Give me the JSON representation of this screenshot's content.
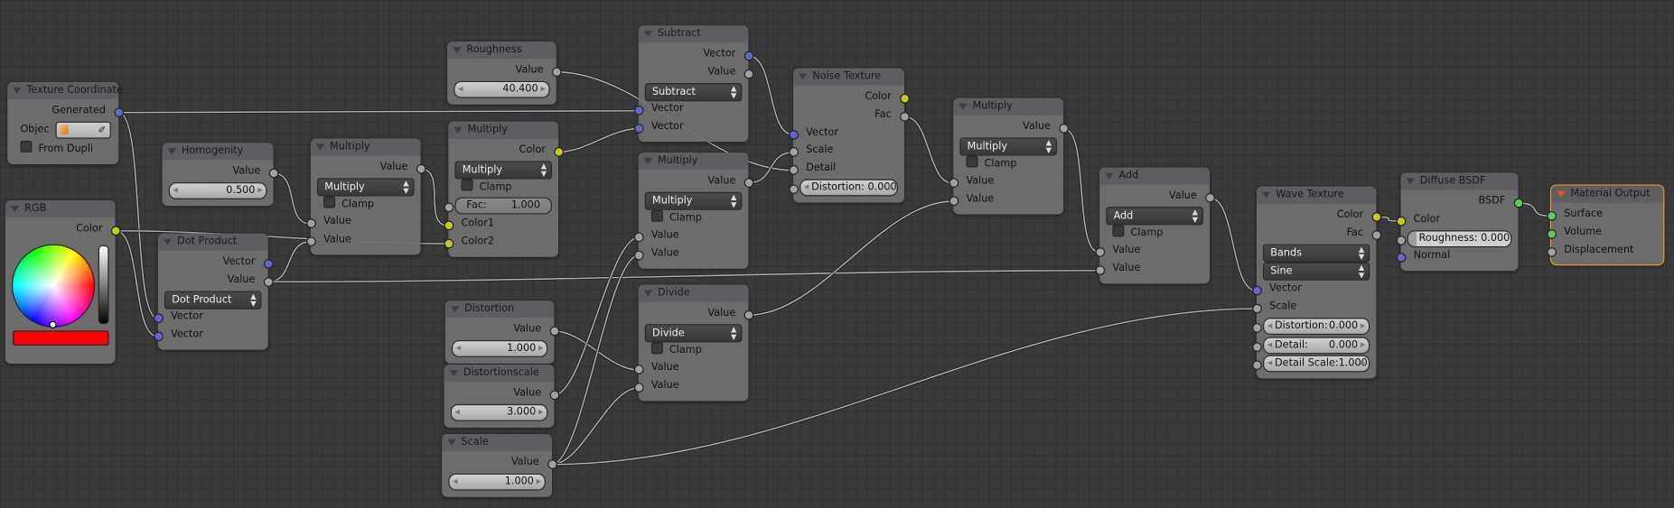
{
  "editor": "node-editor",
  "socket_colors": {
    "vector": "#6464cc",
    "value": "#a1a1a1",
    "color": "#c7c729",
    "shader": "#63c763"
  },
  "link_color": "#b4b4b4",
  "accent_active": "#f0a030",
  "nodes": [
    {
      "id": "texcoord",
      "title": "Texture Coordinate",
      "rows": [
        {
          "kind": "out",
          "label": "Generated",
          "socket": "vector"
        },
        {
          "kind": "object",
          "label": "Objec",
          "icon": "cube-icon",
          "picker_icon": "eyedropper-icon"
        },
        {
          "kind": "check",
          "label": "From Dupli",
          "checked": false
        }
      ]
    },
    {
      "id": "rgb",
      "title": "RGB",
      "rows": [
        {
          "kind": "out",
          "label": "Color",
          "socket": "color"
        },
        {
          "kind": "picker",
          "swatch": "#ff0000"
        }
      ]
    },
    {
      "id": "homogenity",
      "title": "Homogenity",
      "rows": [
        {
          "kind": "out",
          "label": "Value",
          "socket": "value"
        },
        {
          "kind": "field",
          "label": "",
          "value": "0.500",
          "arrows": true
        }
      ]
    },
    {
      "id": "dot",
      "title": "Dot Product",
      "rows": [
        {
          "kind": "out",
          "label": "Vector",
          "socket": "vector"
        },
        {
          "kind": "out",
          "label": "Value",
          "socket": "value"
        },
        {
          "kind": "menu",
          "label": "Dot Product"
        },
        {
          "kind": "in",
          "label": "Vector",
          "socket": "vector"
        },
        {
          "kind": "in",
          "label": "Vector",
          "socket": "vector"
        }
      ]
    },
    {
      "id": "mul1",
      "title": "Multiply",
      "rows": [
        {
          "kind": "out",
          "label": "Value",
          "socket": "value"
        },
        {
          "kind": "menu",
          "label": "Multiply"
        },
        {
          "kind": "check",
          "label": "Clamp",
          "checked": false
        },
        {
          "kind": "in",
          "label": "Value",
          "socket": "value"
        },
        {
          "kind": "in",
          "label": "Value",
          "socket": "value"
        }
      ]
    },
    {
      "id": "roughness",
      "title": "Roughness",
      "rows": [
        {
          "kind": "out",
          "label": "Value",
          "socket": "value"
        },
        {
          "kind": "field",
          "label": "",
          "value": "40.400",
          "arrows": true
        }
      ]
    },
    {
      "id": "mix",
      "title": "Multiply",
      "rows": [
        {
          "kind": "out",
          "label": "Color",
          "socket": "color"
        },
        {
          "kind": "menu",
          "label": "Multiply"
        },
        {
          "kind": "check",
          "label": "Clamp",
          "checked": false
        },
        {
          "kind": "field",
          "label": "Fac:",
          "value": "1.000",
          "socket": "value",
          "plain": true
        },
        {
          "kind": "in",
          "label": "Color1",
          "socket": "color"
        },
        {
          "kind": "in",
          "label": "Color2",
          "socket": "color"
        }
      ]
    },
    {
      "id": "subtract",
      "title": "Subtract",
      "rows": [
        {
          "kind": "out",
          "label": "Vector",
          "socket": "vector"
        },
        {
          "kind": "out",
          "label": "Value",
          "socket": "value"
        },
        {
          "kind": "menu",
          "label": "Subtract"
        },
        {
          "kind": "in",
          "label": "Vector",
          "socket": "vector"
        },
        {
          "kind": "in",
          "label": "Vector",
          "socket": "vector"
        }
      ]
    },
    {
      "id": "mul3",
      "title": "Multiply",
      "rows": [
        {
          "kind": "out",
          "label": "Value",
          "socket": "value"
        },
        {
          "kind": "menu",
          "label": "Multiply"
        },
        {
          "kind": "check",
          "label": "Clamp",
          "checked": false
        },
        {
          "kind": "in",
          "label": "Value",
          "socket": "value"
        },
        {
          "kind": "in",
          "label": "Value",
          "socket": "value"
        }
      ]
    },
    {
      "id": "noise",
      "title": "Noise Texture",
      "rows": [
        {
          "kind": "out",
          "label": "Color",
          "socket": "color"
        },
        {
          "kind": "out",
          "label": "Fac",
          "socket": "value"
        },
        {
          "kind": "in",
          "label": "Vector",
          "socket": "vector"
        },
        {
          "kind": "in",
          "label": "Scale",
          "socket": "value"
        },
        {
          "kind": "in",
          "label": "Detail",
          "socket": "value"
        },
        {
          "kind": "field",
          "label": "Distortion: 0.000",
          "value": "",
          "socket": "value",
          "arrows": true
        }
      ]
    },
    {
      "id": "distortion",
      "title": "Distortion",
      "rows": [
        {
          "kind": "out",
          "label": "Value",
          "socket": "value"
        },
        {
          "kind": "field",
          "label": "",
          "value": "1.000",
          "arrows": true
        }
      ]
    },
    {
      "id": "distscale",
      "title": "Distortionscale",
      "rows": [
        {
          "kind": "out",
          "label": "Value",
          "socket": "value"
        },
        {
          "kind": "field",
          "label": "",
          "value": "3.000",
          "arrows": true
        }
      ]
    },
    {
      "id": "scale",
      "title": "Scale",
      "rows": [
        {
          "kind": "out",
          "label": "Value",
          "socket": "value"
        },
        {
          "kind": "field",
          "label": "",
          "value": "1.000",
          "arrows": true
        }
      ]
    },
    {
      "id": "divide",
      "title": "Divide",
      "rows": [
        {
          "kind": "out",
          "label": "Value",
          "socket": "value"
        },
        {
          "kind": "menu",
          "label": "Divide"
        },
        {
          "kind": "check",
          "label": "Clamp",
          "checked": false
        },
        {
          "kind": "in",
          "label": "Value",
          "socket": "value"
        },
        {
          "kind": "in",
          "label": "Value",
          "socket": "value"
        }
      ]
    },
    {
      "id": "mul4",
      "title": "Multiply",
      "rows": [
        {
          "kind": "out",
          "label": "Value",
          "socket": "value"
        },
        {
          "kind": "menu",
          "label": "Multiply"
        },
        {
          "kind": "check",
          "label": "Clamp",
          "checked": false
        },
        {
          "kind": "in",
          "label": "Value",
          "socket": "value"
        },
        {
          "kind": "in",
          "label": "Value",
          "socket": "value"
        }
      ]
    },
    {
      "id": "add",
      "title": "Add",
      "rows": [
        {
          "kind": "out",
          "label": "Value",
          "socket": "value"
        },
        {
          "kind": "menu",
          "label": "Add"
        },
        {
          "kind": "check",
          "label": "Clamp",
          "checked": false
        },
        {
          "kind": "in",
          "label": "Value",
          "socket": "value"
        },
        {
          "kind": "in",
          "label": "Value",
          "socket": "value"
        }
      ]
    },
    {
      "id": "wave",
      "title": "Wave Texture",
      "rows": [
        {
          "kind": "out",
          "label": "Color",
          "socket": "color"
        },
        {
          "kind": "out",
          "label": "Fac",
          "socket": "value"
        },
        {
          "kind": "menu",
          "label": "Bands"
        },
        {
          "kind": "menu",
          "label": "Sine"
        },
        {
          "kind": "in",
          "label": "Vector",
          "socket": "vector"
        },
        {
          "kind": "in",
          "label": "Scale",
          "socket": "value"
        },
        {
          "kind": "field",
          "label": "Distortion:",
          "value": "0.000",
          "socket": "value",
          "arrows": true
        },
        {
          "kind": "field",
          "label": "Detail:",
          "value": "0.000",
          "socket": "value",
          "arrows": true
        },
        {
          "kind": "field",
          "label": "Detail Scale:",
          "value": "1.000",
          "socket": "value",
          "arrows": true
        }
      ]
    },
    {
      "id": "diffuse",
      "title": "Diffuse BSDF",
      "rows": [
        {
          "kind": "out",
          "label": "BSDF",
          "socket": "shader"
        },
        {
          "kind": "in",
          "label": "Color",
          "socket": "color"
        },
        {
          "kind": "field",
          "label": "Roughness: 0.000",
          "value": "",
          "socket": "value",
          "slider": true,
          "fraction": 0.0
        },
        {
          "kind": "in",
          "label": "Normal",
          "socket": "vector"
        }
      ]
    },
    {
      "id": "output",
      "title": "Material Output",
      "active": true,
      "rows": [
        {
          "kind": "in",
          "label": "Surface",
          "socket": "shader"
        },
        {
          "kind": "in",
          "label": "Volume",
          "socket": "shader"
        },
        {
          "kind": "in",
          "label": "Displacement",
          "socket": "value"
        }
      ]
    }
  ],
  "links": [
    [
      "texcoord",
      0,
      "subtract",
      3
    ],
    [
      "texcoord",
      0,
      "dot",
      3
    ],
    [
      "rgb",
      0,
      "dot",
      4
    ],
    [
      "rgb",
      0,
      "mix",
      5
    ],
    [
      "homogenity",
      0,
      "mul1",
      3
    ],
    [
      "dot",
      1,
      "mul1",
      4
    ],
    [
      "dot",
      1,
      "add",
      4
    ],
    [
      "mul1",
      0,
      "mix",
      4
    ],
    [
      "roughness",
      0,
      "noise",
      4
    ],
    [
      "mix",
      0,
      "subtract",
      4
    ],
    [
      "subtract",
      0,
      "noise",
      2
    ],
    [
      "mul3",
      0,
      "noise",
      3
    ],
    [
      "noise",
      1,
      "mul4",
      3
    ],
    [
      "mul4",
      0,
      "add",
      3
    ],
    [
      "add",
      0,
      "wave",
      4
    ],
    [
      "divide",
      0,
      "mul4",
      4
    ],
    [
      "distortion",
      0,
      "divide",
      3
    ],
    [
      "distscale",
      0,
      "mul3",
      3
    ],
    [
      "scale",
      0,
      "mul3",
      4
    ],
    [
      "scale",
      0,
      "divide",
      4
    ],
    [
      "scale",
      0,
      "wave",
      5
    ],
    [
      "wave",
      0,
      "diffuse",
      1
    ],
    [
      "diffuse",
      0,
      "output",
      0
    ]
  ]
}
